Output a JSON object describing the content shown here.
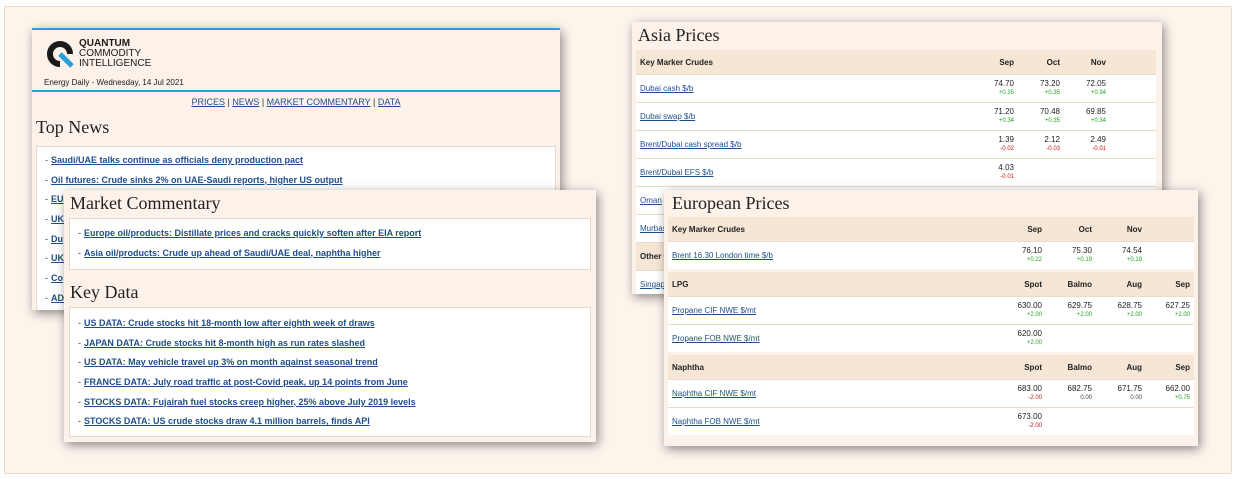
{
  "brand": {
    "line1": "QUANTUM",
    "line2": "COMMODITY",
    "line3": "INTELLIGENCE",
    "dateline": "Energy Daily - Wednesday, 14 Jul 2021"
  },
  "nav": {
    "prices": "PRICES",
    "news": "NEWS",
    "market": "MARKET COMMENTARY",
    "data": "DATA"
  },
  "top_news": {
    "title": "Top News",
    "items": [
      "Saudi/UAE talks continue as officials deny production pact",
      "Oil futures: Crude sinks 2% on UAE-Saudi reports, higher US output",
      "EU",
      "UK",
      "Du",
      "UK",
      "Co",
      "AD"
    ]
  },
  "market_commentary": {
    "title": "Market Commentary",
    "items": [
      "Europe oil/products: Distillate prices and cracks quickly soften after EIA report",
      "Asia oil/products: Crude up ahead of Saudi/UAE deal, naphtha higher"
    ]
  },
  "key_data": {
    "title": "Key Data",
    "items": [
      "US DATA: Crude stocks hit 18-month low after eighth week of draws",
      "JAPAN DATA: Crude stocks hit 8-month high as run rates slashed",
      "US DATA: May vehicle travel up 3% on month against seasonal trend",
      "FRANCE DATA: July road traffic at post-Covid peak, up 14 points from June",
      "STOCKS DATA: Fujairah fuel stocks creep higher, 25% above July 2019 levels",
      "STOCKS DATA: US crude stocks draw 4.1 million barrels, finds API"
    ]
  },
  "asia": {
    "title": "Asia Prices",
    "section": "Key Marker Crudes",
    "cols": [
      "Sep",
      "Oct",
      "Nov"
    ],
    "rows": [
      {
        "name": "Dubai cash $/b",
        "v": [
          "74.70",
          "73.20",
          "72.05"
        ],
        "c": [
          "+0.35",
          "+0.35",
          "+0.34"
        ]
      },
      {
        "name": "Dubai swap $/b",
        "v": [
          "71.20",
          "70.48",
          "69.85"
        ],
        "c": [
          "+0.34",
          "+0.35",
          "+0.34"
        ]
      },
      {
        "name": "Brent/Dubai cash spread $/b",
        "v": [
          "1.39",
          "2.12",
          "2.49"
        ],
        "c": [
          "-0.02",
          "-0.03",
          "-0.01"
        ]
      },
      {
        "name": "Brent/Dubai EFS $/b",
        "v": [
          "4.03",
          "",
          ""
        ],
        "c": [
          "-0.01",
          "",
          ""
        ]
      }
    ],
    "partial": [
      "Oman",
      "Murbas",
      "Other C",
      "Singap"
    ]
  },
  "europe": {
    "title": "European Prices",
    "sections": [
      {
        "label": "Key Marker Crudes",
        "cols": [
          "Sep",
          "Oct",
          "Nov"
        ],
        "rows": [
          {
            "name": "Brent 16.30 London time $/b",
            "v": [
              "76.10",
              "75.30",
              "74.54"
            ],
            "c": [
              "+0.22",
              "+0.19",
              "+0.19"
            ]
          }
        ]
      },
      {
        "label": "LPG",
        "cols": [
          "Spot",
          "Balmo",
          "Aug",
          "Sep"
        ],
        "rows": [
          {
            "name": "Propane CIF NWE $/mt",
            "v": [
              "630.00",
              "629.75",
              "628.75",
              "627.25"
            ],
            "c": [
              "+2.00",
              "+2.00",
              "+2.00",
              "+2.00"
            ]
          },
          {
            "name": "Propane FOB NWE $/mt",
            "v": [
              "620.00",
              "",
              "",
              ""
            ],
            "c": [
              "+2.00",
              "",
              "",
              ""
            ]
          }
        ]
      },
      {
        "label": "Naphtha",
        "cols": [
          "Spot",
          "Balmo",
          "Aug",
          "Sep"
        ],
        "rows": [
          {
            "name": "Naphtha CIF NWE $/mt",
            "v": [
              "683.00",
              "682.75",
              "671.75",
              "662.00"
            ],
            "c": [
              "-2.00",
              "0.00",
              "0.00",
              "+0.75"
            ]
          },
          {
            "name": "Naphtha FOB NWE $/mt",
            "v": [
              "673.00",
              "",
              "",
              ""
            ],
            "c": [
              "-2.00",
              "",
              "",
              ""
            ]
          }
        ]
      }
    ]
  },
  "colors": {
    "link": "#1f4e8c",
    "accent": "#2a9fd8",
    "up": "#22a022",
    "down": "#c2181b"
  }
}
